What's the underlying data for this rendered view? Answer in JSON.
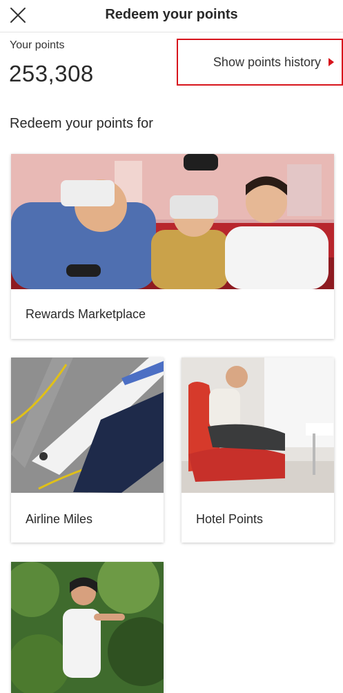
{
  "header": {
    "title": "Redeem your points",
    "close_icon": "close-icon"
  },
  "points": {
    "label": "Your points",
    "value": "253,308"
  },
  "history": {
    "label": "Show points history",
    "accent_color": "#d7141c",
    "arrow_icon": "caret-right-icon"
  },
  "section": {
    "title": "Redeem your points for"
  },
  "cards": [
    {
      "label": "Rewards Marketplace"
    },
    {
      "label": "Airline Miles"
    },
    {
      "label": "Hotel Points"
    },
    {
      "label": ""
    }
  ]
}
